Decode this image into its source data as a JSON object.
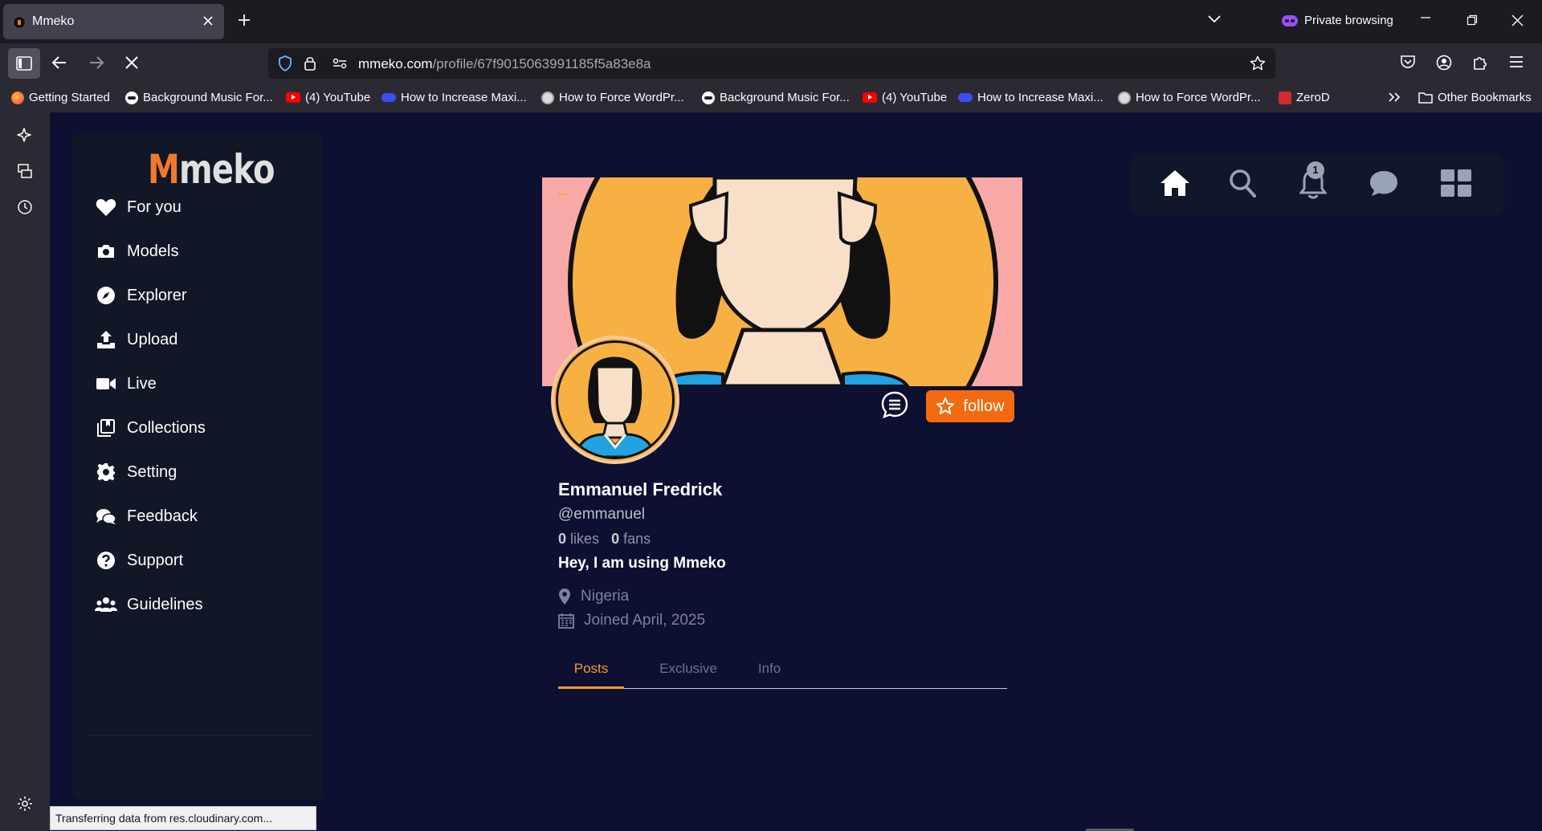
{
  "browser": {
    "tab_title": "Mmeko",
    "private_label": "Private browsing",
    "url_host": "mmeko.com",
    "url_path": "/profile/67f9015063991185f5a83e8a",
    "bookmarks": [
      {
        "label": "Getting Started",
        "icon": "firefox-icon"
      },
      {
        "label": "Background Music For...",
        "icon": "music-icon"
      },
      {
        "label": "(4) YouTube",
        "icon": "youtube-icon"
      },
      {
        "label": "How to Increase Maxi...",
        "icon": "cloud-icon"
      },
      {
        "label": "How to Force WordPr...",
        "icon": "wordpress-icon"
      },
      {
        "label": "Background Music For...",
        "icon": "music-icon"
      },
      {
        "label": "(4) YouTube",
        "icon": "youtube-icon"
      },
      {
        "label": "How to Increase Maxi...",
        "icon": "cloud-icon"
      },
      {
        "label": "How to Force WordPr...",
        "icon": "wordpress-icon"
      },
      {
        "label": "ZeroD",
        "icon": "zerod-icon"
      }
    ],
    "other_bookmarks": "Other Bookmarks",
    "status_text": "Transferring data from res.cloudinary.com..."
  },
  "app": {
    "logo_m": "M",
    "logo_rest": "meko",
    "nav": [
      {
        "label": "For you",
        "icon": "heart-icon"
      },
      {
        "label": "Models",
        "icon": "camera-icon"
      },
      {
        "label": "Explorer",
        "icon": "compass-icon"
      },
      {
        "label": "Upload",
        "icon": "upload-icon"
      },
      {
        "label": "Live",
        "icon": "video-icon"
      },
      {
        "label": "Collections",
        "icon": "collections-icon"
      },
      {
        "label": "Setting",
        "icon": "gear-icon"
      },
      {
        "label": "Feedback",
        "icon": "comments-icon"
      },
      {
        "label": "Support",
        "icon": "question-icon"
      },
      {
        "label": "Guidelines",
        "icon": "users-icon"
      }
    ],
    "topnav": {
      "notification_count": "1"
    }
  },
  "profile": {
    "name": "Emmanuel Fredrick",
    "handle": "@emmanuel",
    "likes": "0",
    "likes_label": "likes",
    "fans": "0",
    "fans_label": "fans",
    "bio": "Hey, I am using Mmeko",
    "location": "Nigeria",
    "joined": "Joined April, 2025",
    "follow_label": "follow",
    "tabs": [
      "Posts",
      "Exclusive",
      "Info"
    ],
    "active_tab": "Posts"
  },
  "colors": {
    "accent_orange": "#f36a10",
    "page_bg": "#0d1030",
    "sidebar_bg": "#111726",
    "cover_bg": "#f9a8a8",
    "avatar_bg": "#f7b042"
  }
}
